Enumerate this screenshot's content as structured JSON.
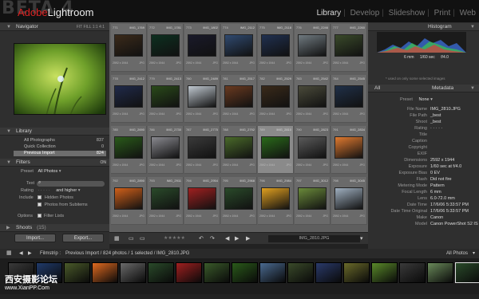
{
  "app": {
    "beta": "BETA 4",
    "brand_adobe": "Adobe",
    "brand_name": "Lightroom"
  },
  "modules": [
    "Library",
    "Develop",
    "Slideshow",
    "Print",
    "Web"
  ],
  "navigator": {
    "title": "Navigator",
    "options": "FIT  FILL  1:1  4:1"
  },
  "library": {
    "title": "Library",
    "items": [
      {
        "label": "All Photographs",
        "count": "837"
      },
      {
        "label": "Quick Collection",
        "count": "0"
      },
      {
        "label": "Previous Import",
        "count": "824"
      }
    ]
  },
  "filters": {
    "title": "Filters",
    "on": "ON",
    "preset_label": "Preset",
    "preset_value": "All Photos",
    "text_label": "Text",
    "rating_label": "Rating",
    "rating_value": "and higher",
    "include_label": "Include",
    "include_hidden": "Hidden Photos",
    "include_subitems": "Photos from Subitems",
    "options_label": "Options",
    "filter_lists": "Filter Lists"
  },
  "shoots": {
    "title": "Shoots",
    "count": "(15)"
  },
  "buttons": {
    "import": "Import...",
    "export": "Export..."
  },
  "grid": {
    "rows": [
      [
        {
          "num": "771",
          "name": "IMG_1769"
        },
        {
          "num": "772",
          "name": "IMG_1781"
        },
        {
          "num": "773",
          "name": "IMG_1802"
        },
        {
          "num": "774",
          "name": "IMG_2112"
        },
        {
          "num": "775",
          "name": "IMG_2118"
        },
        {
          "num": "776",
          "name": "IMG_2246"
        },
        {
          "num": "777",
          "name": "IMG_2260"
        }
      ],
      [
        {
          "num": "778",
          "name": "IMG_2412"
        },
        {
          "num": "779",
          "name": "IMG_2413"
        },
        {
          "num": "780",
          "name": "IMG_2489"
        },
        {
          "num": "781",
          "name": "IMG_2517"
        },
        {
          "num": "782",
          "name": "IMG_2529"
        },
        {
          "num": "783",
          "name": "IMG_2542"
        },
        {
          "num": "784",
          "name": "IMG_2545"
        }
      ],
      [
        {
          "num": "785",
          "name": "IMG_2690"
        },
        {
          "num": "786",
          "name": "IMG_2730"
        },
        {
          "num": "787",
          "name": "IMG_2775"
        },
        {
          "num": "788",
          "name": "IMG_2792"
        },
        {
          "num": "789",
          "name": "IMG_2810"
        },
        {
          "num": "790",
          "name": "IMG_2823"
        },
        {
          "num": "791",
          "name": "IMG_2834"
        }
      ],
      [
        {
          "num": "792",
          "name": "IMG_2890"
        },
        {
          "num": "793",
          "name": "IMG_2911"
        },
        {
          "num": "794",
          "name": "IMG_2954"
        },
        {
          "num": "795",
          "name": "IMG_2968"
        },
        {
          "num": "796",
          "name": "IMG_2984"
        },
        {
          "num": "797",
          "name": "IMG_3012"
        },
        {
          "num": "798",
          "name": "IMG_3045"
        }
      ]
    ],
    "dims": "2592 x 1944",
    "ext": "JPG"
  },
  "toolbar": {
    "filename": "IMG_2810.JPG"
  },
  "histogram": {
    "title": "Histogram",
    "focal": "6 mm",
    "shutter": "1/60 sec",
    "aperture": "f/4.0",
    "note": "* used on only some selected images"
  },
  "metadata": {
    "title": "Metadata",
    "scope": "All",
    "preset_label": "Preset",
    "preset_value": "None",
    "fields": [
      {
        "k": "File Name",
        "v": "IMG_2810.JPG"
      },
      {
        "k": "File Path",
        "v": "_best"
      },
      {
        "k": "Shoot",
        "v": "_best"
      },
      {
        "k": "Rating",
        "v": "· · · · ·"
      },
      {
        "k": "Title",
        "v": ""
      },
      {
        "k": "Caption",
        "v": ""
      },
      {
        "k": "Copyright",
        "v": ""
      },
      {
        "k": "EXIF",
        "v": ""
      },
      {
        "k": "Dimensions",
        "v": "2592 x 1944"
      },
      {
        "k": "Exposure",
        "v": "1/60 sec at f/4.0"
      },
      {
        "k": "Exposure Bias",
        "v": "0 EV"
      },
      {
        "k": "Flash",
        "v": "Did not fire"
      },
      {
        "k": "Metering Mode",
        "v": "Pattern"
      },
      {
        "k": "Focal Length",
        "v": "6 mm"
      },
      {
        "k": "Lens",
        "v": "6.0-72.0 mm"
      },
      {
        "k": "Date Time",
        "v": "17/6/06 5:33:57 PM"
      },
      {
        "k": "Date Time Original",
        "v": "17/6/06 5:33:57 PM"
      },
      {
        "k": "Make",
        "v": "Canon"
      },
      {
        "k": "Model",
        "v": "Canon PowerShot S2 IS"
      }
    ]
  },
  "filmstrip": {
    "label": "Filmstrip :",
    "info": "Previous Import / 824 photos / 1 selected / IMG_2810.JPG",
    "filter": "All Photos"
  },
  "watermark": {
    "cn": "西安摄影论坛",
    "url": "www.XianPP.Com"
  },
  "colors": {
    "accent_red": "#d22222",
    "selected_row": "#6e6e6e"
  }
}
